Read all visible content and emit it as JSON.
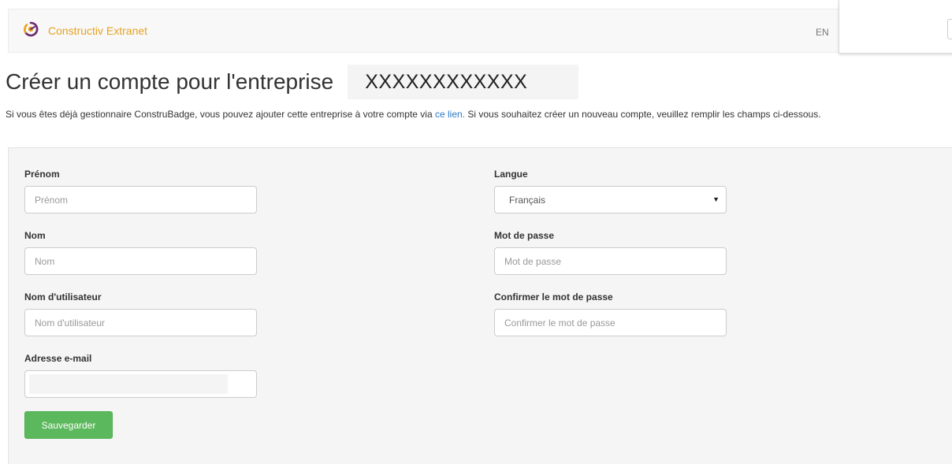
{
  "navbar": {
    "brand_name": "Constructiv Extranet",
    "brand_icon": "constructiv-logo-icon",
    "language_link": "EN"
  },
  "page": {
    "title": "Créer un compte pour l'entreprise",
    "company_name": "XXXXXXXXXXXX",
    "intro_before_link": "Si vous êtes déjà gestionnaire ConstruBadge, vous pouvez ajouter cette entreprise à votre compte via ",
    "intro_link": "ce lien.",
    "intro_after_link": " Si vous souhaitez créer un nouveau compte, veuillez remplir les champs ci-dessous."
  },
  "form": {
    "first_name": {
      "label": "Prénom",
      "placeholder": "Prénom",
      "value": ""
    },
    "last_name": {
      "label": "Nom",
      "placeholder": "Nom",
      "value": ""
    },
    "username": {
      "label": "Nom d'utilisateur",
      "placeholder": "Nom d'utilisateur",
      "value": ""
    },
    "email": {
      "label": "Adresse e-mail",
      "value": ""
    },
    "language": {
      "label": "Langue",
      "selected": "Français"
    },
    "password": {
      "label": "Mot de passe",
      "placeholder": "Mot de passe",
      "value": ""
    },
    "confirm_password": {
      "label": "Confirmer le mot de passe",
      "placeholder": "Confirmer le mot de passe",
      "value": ""
    },
    "save_label": "Sauvegarder"
  },
  "colors": {
    "brand": "#e8a21e",
    "link": "#2a7ac8",
    "button": "#5cb85c",
    "panel": "#f5f5f5"
  }
}
